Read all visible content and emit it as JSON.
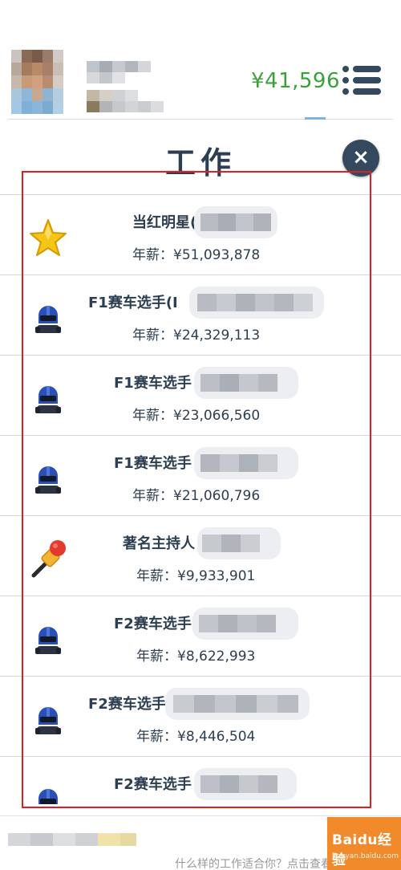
{
  "header": {
    "balance": "¥41,596",
    "colors": {
      "balance": "#3aa13a",
      "accent": "#34495e"
    }
  },
  "modal": {
    "title": "工作",
    "close_label": "×"
  },
  "jobs": [
    {
      "name": "当红明星(",
      "salary": "年薪：¥51,093,878",
      "icon": "star-icon"
    },
    {
      "name": "F1赛车选手(I",
      "salary": "年薪：¥24,329,113",
      "icon": "racer-helmet-icon"
    },
    {
      "name": "F1赛车选手",
      "salary": "年薪：¥23,066,560",
      "icon": "racer-helmet-icon"
    },
    {
      "name": "F1赛车选手",
      "salary": "年薪：¥21,060,796",
      "icon": "racer-helmet-icon"
    },
    {
      "name": "著名主持人",
      "salary": "年薪：¥9,933,901",
      "icon": "microphone-icon"
    },
    {
      "name": "F2赛车选手",
      "salary": "年薪：¥8,622,993",
      "icon": "racer-helmet-icon"
    },
    {
      "name": "F2赛车选手",
      "salary": "年薪：¥8,446,504",
      "icon": "racer-helmet-icon"
    },
    {
      "name": "F2赛车选手",
      "salary": "",
      "icon": "racer-helmet-icon"
    }
  ],
  "footer": {
    "text": "什么样的工作适合你？点击查看试试"
  },
  "watermark": {
    "logo": "Baidu经验",
    "url": "jingyan.baidu.com"
  }
}
